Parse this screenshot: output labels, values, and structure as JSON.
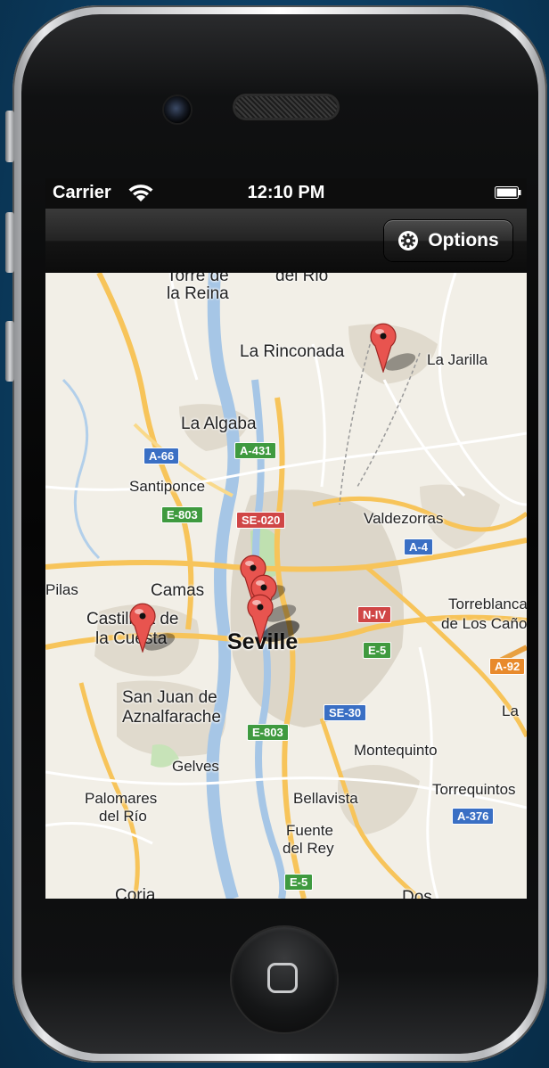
{
  "status": {
    "carrier": "Carrier",
    "time": "12:10 PM"
  },
  "navbar": {
    "options_label": "Options",
    "options_icon": "gear-icon"
  },
  "map": {
    "places": [
      {
        "key": "torre",
        "text": "Torre de"
      },
      {
        "key": "torre2",
        "text": "la Reina"
      },
      {
        "key": "delrio",
        "text": "del Rio"
      },
      {
        "key": "rinconada",
        "text": "La Rinconada"
      },
      {
        "key": "jarilla",
        "text": "La Jarilla"
      },
      {
        "key": "algaba",
        "text": "La Algaba"
      },
      {
        "key": "santiponce",
        "text": "Santiponce"
      },
      {
        "key": "valdezorras",
        "text": "Valdezorras"
      },
      {
        "key": "pilas",
        "text": "Pilas"
      },
      {
        "key": "camas",
        "text": "Camas"
      },
      {
        "key": "castilleja1",
        "text": "Castilleja de"
      },
      {
        "key": "castilleja2",
        "text": "la Cuesta"
      },
      {
        "key": "seville",
        "text": "Seville"
      },
      {
        "key": "torreblanca1",
        "text": "Torreblanca"
      },
      {
        "key": "torreblanca2",
        "text": "de Los Caños"
      },
      {
        "key": "sanjuan1",
        "text": "San Juan de"
      },
      {
        "key": "sanjuan2",
        "text": "Aznalfarache"
      },
      {
        "key": "la",
        "text": "La"
      },
      {
        "key": "montequinto",
        "text": "Montequinto"
      },
      {
        "key": "gelves",
        "text": "Gelves"
      },
      {
        "key": "palomares1",
        "text": "Palomares"
      },
      {
        "key": "palomares2",
        "text": "del Río"
      },
      {
        "key": "bellavista",
        "text": "Bellavista"
      },
      {
        "key": "torrequintos",
        "text": "Torrequintos"
      },
      {
        "key": "fuente1",
        "text": "Fuente"
      },
      {
        "key": "fuente2",
        "text": "del Rey"
      },
      {
        "key": "coria",
        "text": "Coria"
      },
      {
        "key": "dos",
        "text": "Dos"
      }
    ],
    "shields": [
      {
        "key": "a66",
        "text": "A-66",
        "color": "#3a6fc4"
      },
      {
        "key": "a431",
        "text": "A-431",
        "color": "#3f9a3f"
      },
      {
        "key": "e803a",
        "text": "E-803",
        "color": "#3f9a3f"
      },
      {
        "key": "se020",
        "text": "SE-020",
        "color": "#d04646"
      },
      {
        "key": "a4",
        "text": "A-4",
        "color": "#3a6fc4"
      },
      {
        "key": "niv",
        "text": "N-IV",
        "color": "#d04646"
      },
      {
        "key": "e5a",
        "text": "E-5",
        "color": "#3f9a3f"
      },
      {
        "key": "a92",
        "text": "A-92",
        "color": "#e88a2c"
      },
      {
        "key": "se30",
        "text": "SE-30",
        "color": "#3a6fc4"
      },
      {
        "key": "e803b",
        "text": "E-803",
        "color": "#3f9a3f"
      },
      {
        "key": "a376",
        "text": "A-376",
        "color": "#3a6fc4"
      },
      {
        "key": "e5b",
        "text": "E-5",
        "color": "#3f9a3f"
      }
    ]
  }
}
